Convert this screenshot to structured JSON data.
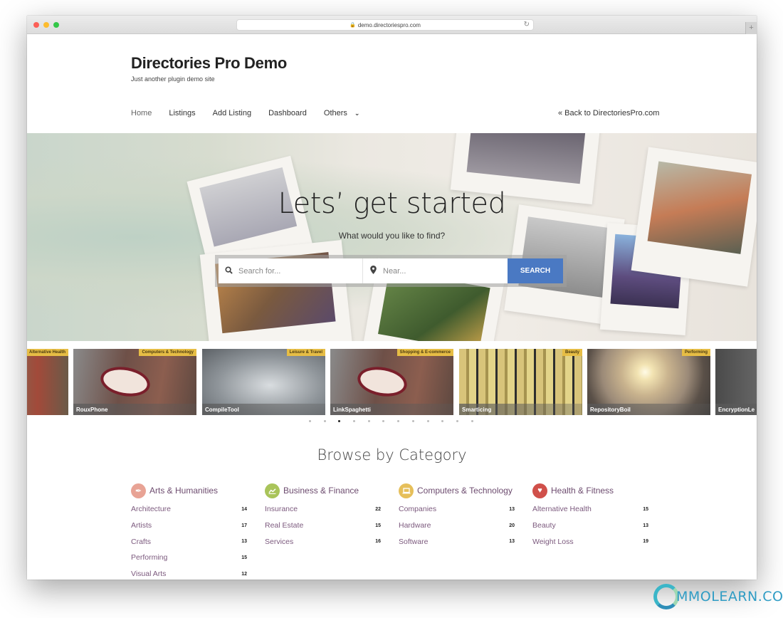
{
  "browser": {
    "url": "demo.directoriespro.com",
    "lock_icon": "lock-icon",
    "reload_icon": "reload-icon",
    "new_tab_label": "+"
  },
  "site": {
    "title": "Directories Pro Demo",
    "tagline": "Just another plugin demo site"
  },
  "nav": {
    "items": [
      {
        "label": "Home",
        "active": true
      },
      {
        "label": "Listings"
      },
      {
        "label": "Add Listing"
      },
      {
        "label": "Dashboard"
      },
      {
        "label": "Others",
        "dropdown": true
      }
    ],
    "back_link": "« Back to DirectoriesPro.com"
  },
  "hero": {
    "title": "Lets’ get started",
    "subtitle": "What would you like to find?",
    "search": {
      "keyword_placeholder": "Search for...",
      "keyword_value": "",
      "near_placeholder": "Near...",
      "near_value": "",
      "button_label": "SEARCH",
      "button_color": "#4a79c3"
    }
  },
  "carousel": {
    "slides": [
      {
        "category": "Alternative Health",
        "name": ""
      },
      {
        "category": "Computers & Technology",
        "name": "RouxPhone"
      },
      {
        "category": "Leisure & Travel",
        "name": "CompileTool"
      },
      {
        "category": "Shopping & E-commerce",
        "name": "LinkSpaghetti"
      },
      {
        "category": "Beauty",
        "name": "Smarticing"
      },
      {
        "category": "Performing",
        "name": "RepositoryBoil"
      },
      {
        "category": "",
        "name": "EncryptionLe"
      }
    ],
    "badge_color": "#e6bd45",
    "dot_count": 12,
    "active_dot": 3
  },
  "browse": {
    "title": "Browse by Category",
    "categories": [
      {
        "name": "Arts & Humanities",
        "icon": "paintbrush-icon",
        "color": "#e8a395",
        "items": [
          {
            "label": "Architecture",
            "count": "14"
          },
          {
            "label": "Artists",
            "count": "17"
          },
          {
            "label": "Crafts",
            "count": "13"
          },
          {
            "label": "Performing",
            "count": "15"
          },
          {
            "label": "Visual Arts",
            "count": "12"
          }
        ]
      },
      {
        "name": "Business & Finance",
        "icon": "chart-icon",
        "color": "#a9c45a",
        "items": [
          {
            "label": "Insurance",
            "count": "22"
          },
          {
            "label": "Real Estate",
            "count": "15"
          },
          {
            "label": "Services",
            "count": "16"
          }
        ]
      },
      {
        "name": "Computers & Technology",
        "icon": "laptop-icon",
        "color": "#e6bf5a",
        "items": [
          {
            "label": "Companies",
            "count": "13"
          },
          {
            "label": "Hardware",
            "count": "20"
          },
          {
            "label": "Software",
            "count": "13"
          }
        ]
      },
      {
        "name": "Health & Fitness",
        "icon": "heart-icon",
        "color": "#d0504a",
        "items": [
          {
            "label": "Alternative Health",
            "count": "15"
          },
          {
            "label": "Beauty",
            "count": "13"
          },
          {
            "label": "Weight Loss",
            "count": "19"
          }
        ]
      }
    ]
  },
  "watermark": {
    "text": "MMOLEARN.COM"
  }
}
